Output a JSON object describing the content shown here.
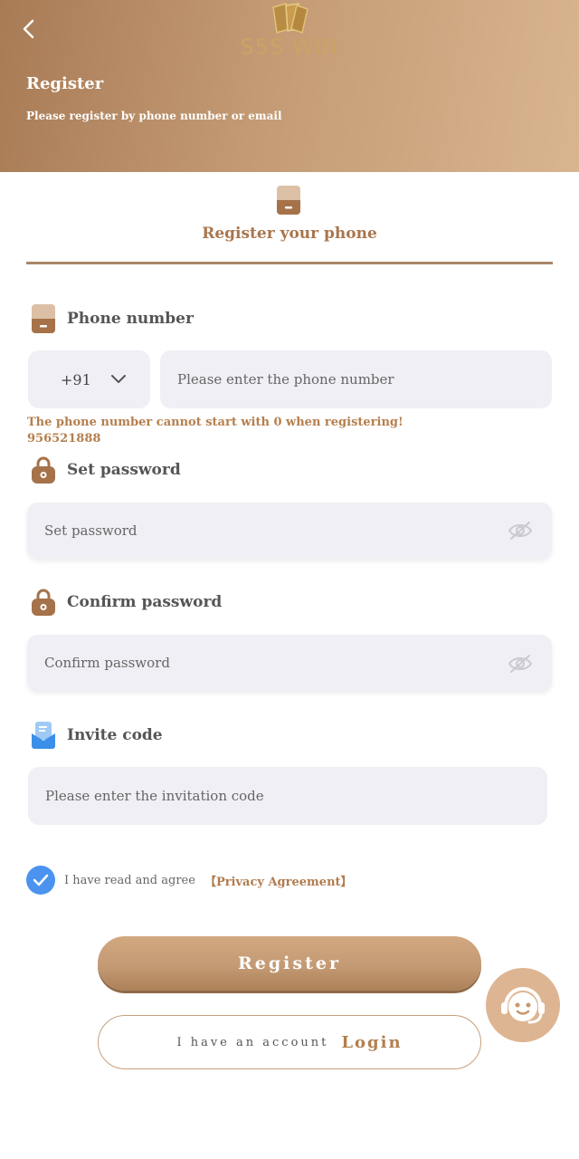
{
  "header": {
    "logo_text": "S5S WIN",
    "title": "Register",
    "subtitle": "Please register by phone number or email"
  },
  "tab": {
    "label": "Register your phone"
  },
  "form": {
    "phone": {
      "label": "Phone number",
      "country_code": "+91",
      "placeholder": "Please enter the phone number",
      "error": "The phone number cannot start with 0 when registering!",
      "error_value": "956521888"
    },
    "password": {
      "label": "Set password",
      "placeholder": "Set password"
    },
    "confirm": {
      "label": "Confirm password",
      "placeholder": "Confirm password"
    },
    "invite": {
      "label": "Invite code",
      "placeholder": "Please enter the invitation code"
    }
  },
  "agreement": {
    "checked": true,
    "text": "I have read and agree",
    "link": "【Privacy Agreement】"
  },
  "buttons": {
    "register": "Register",
    "login_prefix": "I have an account",
    "login_link": "Login"
  },
  "colors": {
    "accent": "#b07c4f",
    "header_start": "#a87b55",
    "header_end": "#d9b58f",
    "checkbox": "#4b93ee",
    "input_bg": "#efeff5"
  },
  "icons": [
    "back-arrow-icon",
    "phone-icon",
    "lock-icon",
    "invite-icon",
    "eye-off-icon",
    "chevron-down-icon",
    "checkmark-icon",
    "customer-service-icon"
  ]
}
